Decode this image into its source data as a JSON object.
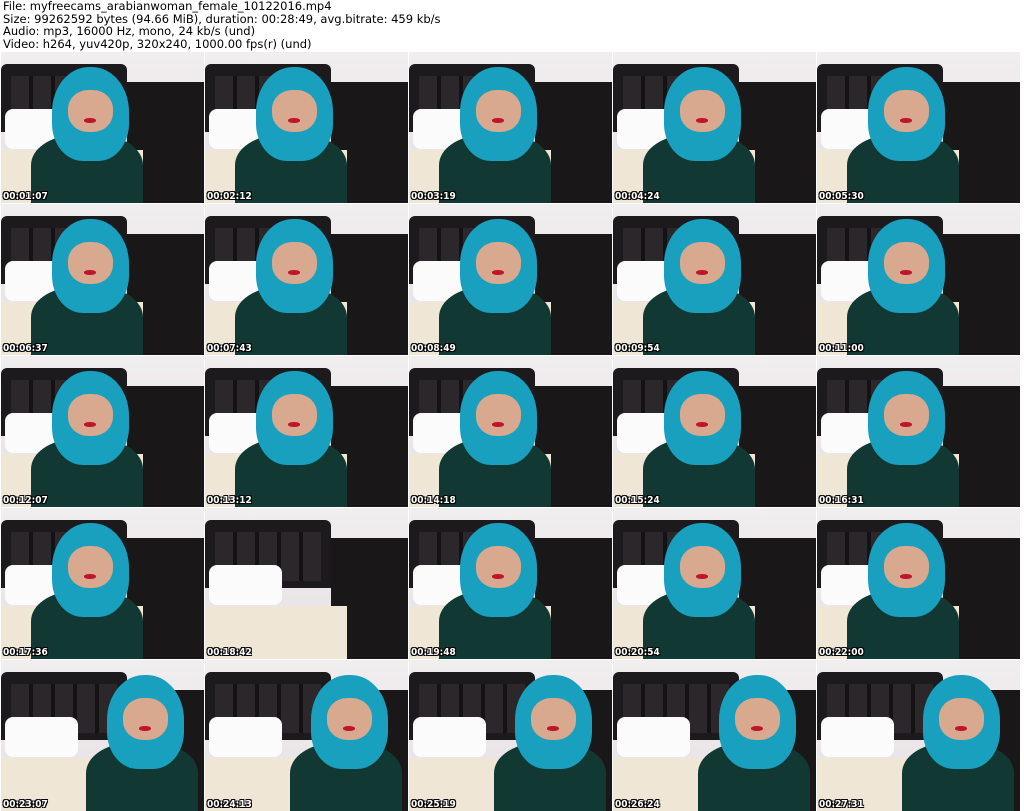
{
  "header": {
    "file": "File: myfreecams_arabianwoman_female_10122016.mp4",
    "size": "Size: 99262592 bytes (94.66 MiB), duration: 00:28:49, avg.bitrate: 459 kb/s",
    "audio": "Audio: mp3, 16000 Hz, mono, 24 kb/s (und)",
    "video": "Video: h264, yuv420p, 320x240, 1000.00 fps(r) (und)"
  },
  "thumbnails": [
    "00:01:07",
    "00:02:12",
    "00:03:19",
    "00:04:24",
    "00:05:30",
    "00:06:37",
    "00:07:43",
    "00:08:49",
    "00:09:54",
    "00:11:00",
    "00:12:07",
    "00:13:12",
    "00:14:18",
    "00:15:24",
    "00:16:31",
    "00:17:36",
    "00:18:42",
    "00:19:48",
    "00:20:54",
    "00:22:00",
    "00:23:07",
    "00:24:13",
    "00:25:19",
    "00:26:24",
    "00:27:31"
  ]
}
